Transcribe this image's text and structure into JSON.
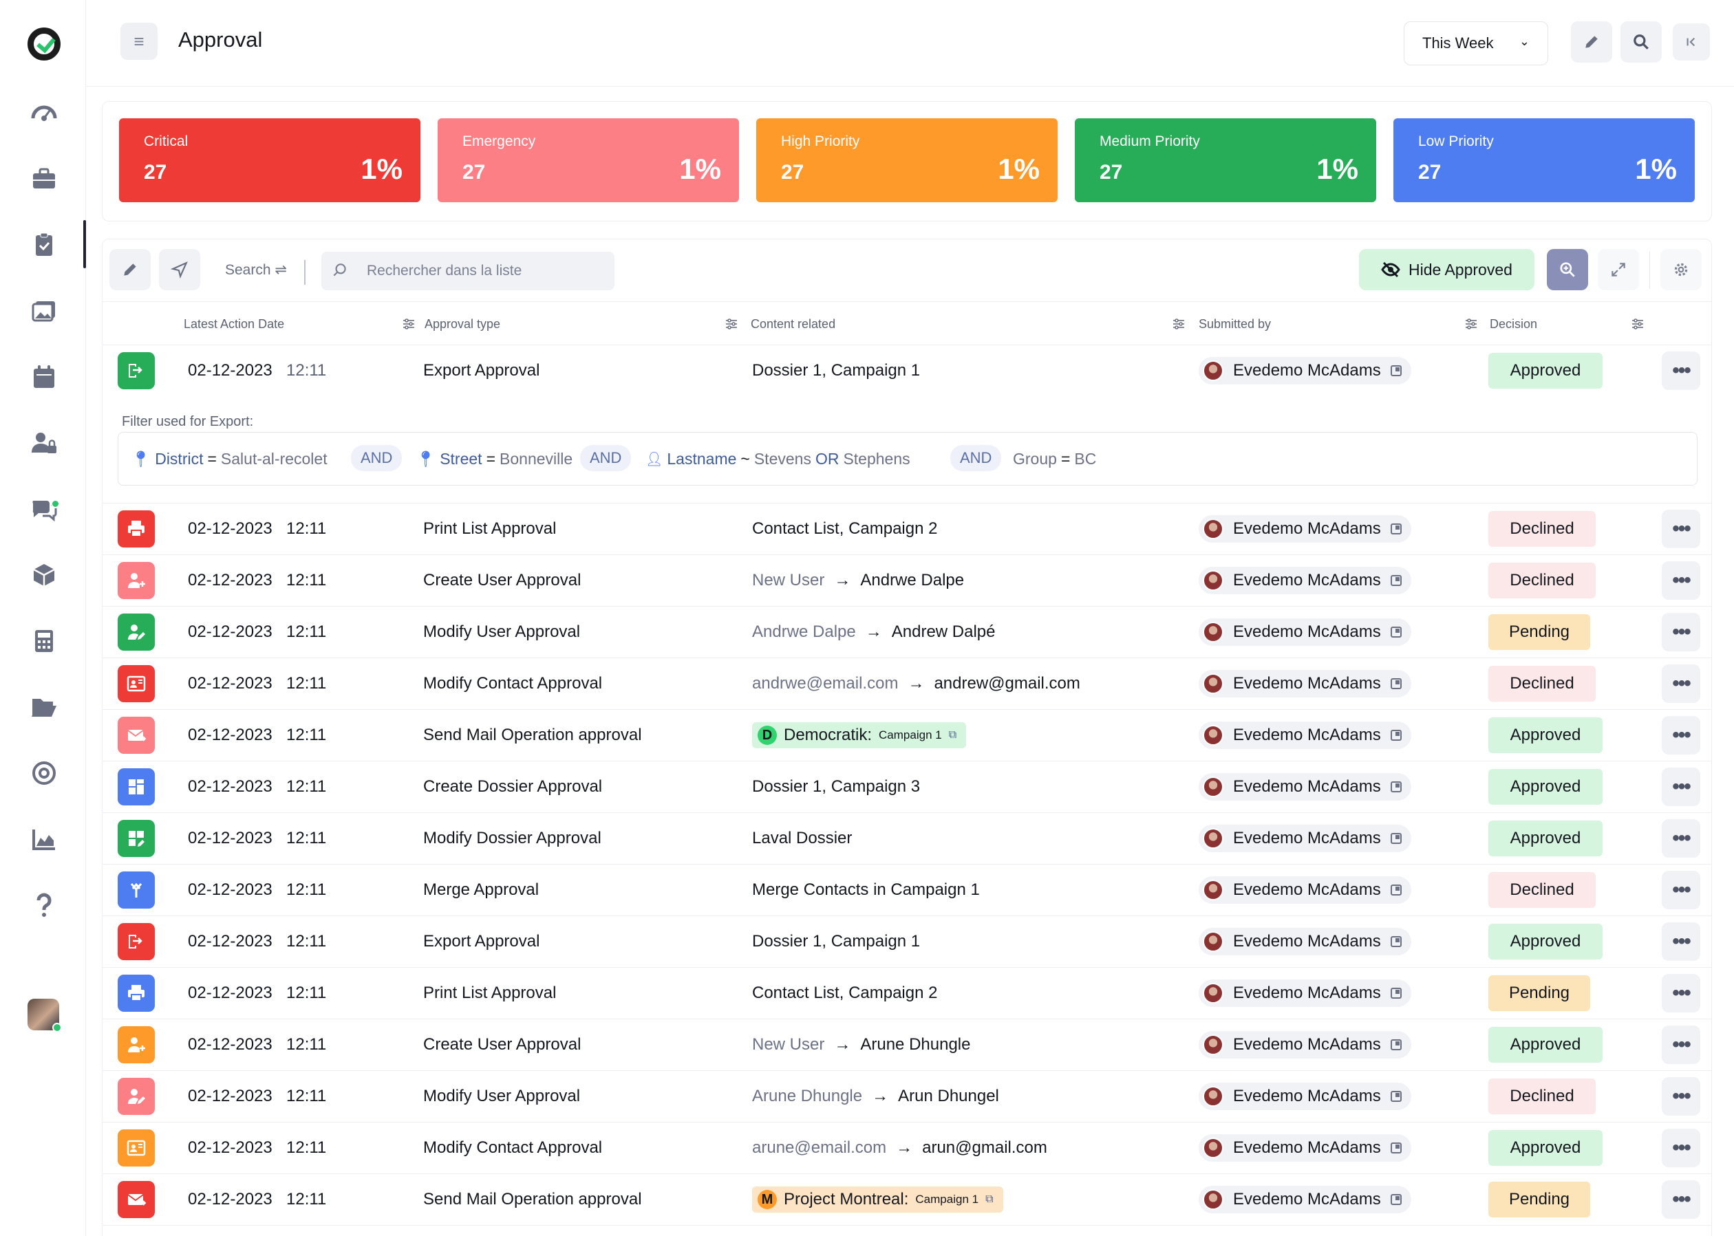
{
  "header": {
    "title": "Approval",
    "period": "This Week"
  },
  "stats": [
    {
      "label": "Critical",
      "count": "27",
      "pct": "1%",
      "color": "#ee3b36"
    },
    {
      "label": "Emergency",
      "count": "27",
      "pct": "1%",
      "color": "#fd7f86"
    },
    {
      "label": "High Priority",
      "count": "27",
      "pct": "1%",
      "color": "#fd9a2a"
    },
    {
      "label": "Medium Priority",
      "count": "27",
      "pct": "1%",
      "color": "#27ad58"
    },
    {
      "label": "Low Priority",
      "count": "27",
      "pct": "1%",
      "color": "#4e7cf1"
    }
  ],
  "toolbar": {
    "search_label": "Search",
    "search_placeholder": "Rechercher dans la liste",
    "hide_approved": "Hide Approved"
  },
  "columns": {
    "date": "Latest Action Date",
    "type": "Approval type",
    "content": "Content related",
    "submitted": "Submitted by",
    "decision": "Decision"
  },
  "export_filter": {
    "label": "Filter used for Export:",
    "district_key": "District",
    "district_op": "=",
    "district_val": "Salut-al-recolet",
    "and1": "AND",
    "street_key": "Street",
    "street_op": "=",
    "street_val": "Bonneville",
    "and2": "AND",
    "lastname_key": "Lastname",
    "lastname_op": "~",
    "lastname_val1": "Stevens",
    "lastname_or": "OR",
    "lastname_val2": "Stephens",
    "and3": "AND",
    "group_key": "Group",
    "group_op": "=",
    "group_val": "BC"
  },
  "rows": [
    {
      "icon": "export-icon",
      "color": "#27ad58",
      "date": "02-12-2023",
      "time": "12:11",
      "type": "Export Approval",
      "content": "Dossier 1, Campaign 1",
      "submitted": "Evedemo McAdams",
      "decision": "Approved",
      "status": "approved"
    },
    {
      "icon": "printer-icon",
      "color": "#ee3b36",
      "date": "02-12-2023",
      "time": "12:11",
      "type": "Print List Approval",
      "content": "Contact List, Campaign 2",
      "submitted": "Evedemo McAdams",
      "decision": "Declined",
      "status": "declined"
    },
    {
      "icon": "user-plus-icon",
      "color": "#fd7f86",
      "date": "02-12-2023",
      "time": "12:11",
      "type": "Create User Approval",
      "from": "New User",
      "to": "Andrwe Dalpe",
      "submitted": "Evedemo McAdams",
      "decision": "Declined",
      "status": "declined"
    },
    {
      "icon": "user-edit-icon",
      "color": "#27ad58",
      "date": "02-12-2023",
      "time": "12:11",
      "type": "Modify User Approval",
      "from": "Andrwe Dalpe",
      "to": "Andrew Dalpé",
      "submitted": "Evedemo McAdams",
      "decision": "Pending",
      "status": "pending"
    },
    {
      "icon": "contact-card-icon",
      "color": "#ee3b36",
      "date": "02-12-2023",
      "time": "12:11",
      "type": "Modify Contact Approval",
      "from": "andrwe@email.com",
      "to": "andrew@gmail.com",
      "submitted": "Evedemo McAdams",
      "decision": "Declined",
      "status": "declined"
    },
    {
      "icon": "mail-send-icon",
      "color": "#fd7f86",
      "date": "02-12-2023",
      "time": "12:11",
      "type": "Send Mail Operation approval",
      "pill_letter": "D",
      "pill_name": "Democratik:",
      "pill_sub": "Campaign 1",
      "pill_bg": "#d5f5df",
      "pill_dot": "#2fd46f",
      "submitted": "Evedemo McAdams",
      "decision": "Approved",
      "status": "approved"
    },
    {
      "icon": "dossier-icon",
      "color": "#4e7cf1",
      "date": "02-12-2023",
      "time": "12:11",
      "type": "Create Dossier Approval",
      "content": "Dossier 1, Campaign 3",
      "submitted": "Evedemo McAdams",
      "decision": "Approved",
      "status": "approved"
    },
    {
      "icon": "dossier-edit-icon",
      "color": "#27ad58",
      "date": "02-12-2023",
      "time": "12:11",
      "type": "Modify Dossier Approval",
      "content": "Laval Dossier",
      "submitted": "Evedemo McAdams",
      "decision": "Approved",
      "status": "approved"
    },
    {
      "icon": "merge-icon",
      "color": "#4e7cf1",
      "date": "02-12-2023",
      "time": "12:11",
      "type": "Merge Approval",
      "content": "Merge Contacts in Campaign 1",
      "submitted": "Evedemo McAdams",
      "decision": "Declined",
      "status": "declined"
    },
    {
      "icon": "export-icon",
      "color": "#ee3b36",
      "date": "02-12-2023",
      "time": "12:11",
      "type": "Export Approval",
      "content": "Dossier 1, Campaign 1",
      "submitted": "Evedemo McAdams",
      "decision": "Approved",
      "status": "approved"
    },
    {
      "icon": "printer-icon",
      "color": "#4e7cf1",
      "date": "02-12-2023",
      "time": "12:11",
      "type": "Print List Approval",
      "content": "Contact List, Campaign 2",
      "submitted": "Evedemo McAdams",
      "decision": "Pending",
      "status": "pending"
    },
    {
      "icon": "user-plus-icon",
      "color": "#fd9a2a",
      "date": "02-12-2023",
      "time": "12:11",
      "type": "Create User Approval",
      "from": "New User",
      "to": "Arune Dhungle",
      "submitted": "Evedemo McAdams",
      "decision": "Approved",
      "status": "approved"
    },
    {
      "icon": "user-edit-icon",
      "color": "#fd7f86",
      "date": "02-12-2023",
      "time": "12:11",
      "type": "Modify User Approval",
      "from": "Arune Dhungle",
      "to": "Arun Dhungel",
      "submitted": "Evedemo McAdams",
      "decision": "Declined",
      "status": "declined"
    },
    {
      "icon": "contact-card-icon",
      "color": "#fd9a2a",
      "date": "02-12-2023",
      "time": "12:11",
      "type": "Modify Contact Approval",
      "from": "arune@email.com",
      "to": "arun@gmail.com",
      "submitted": "Evedemo McAdams",
      "decision": "Approved",
      "status": "approved"
    },
    {
      "icon": "mail-send-icon",
      "color": "#ee3b36",
      "date": "02-12-2023",
      "time": "12:11",
      "type": "Send Mail Operation approval",
      "pill_letter": "M",
      "pill_name": "Project Montreal:",
      "pill_sub": "Campaign 1",
      "pill_bg": "#fde4c4",
      "pill_dot": "#fd9a2a",
      "submitted": "Evedemo McAdams",
      "decision": "Pending",
      "status": "pending"
    }
  ]
}
